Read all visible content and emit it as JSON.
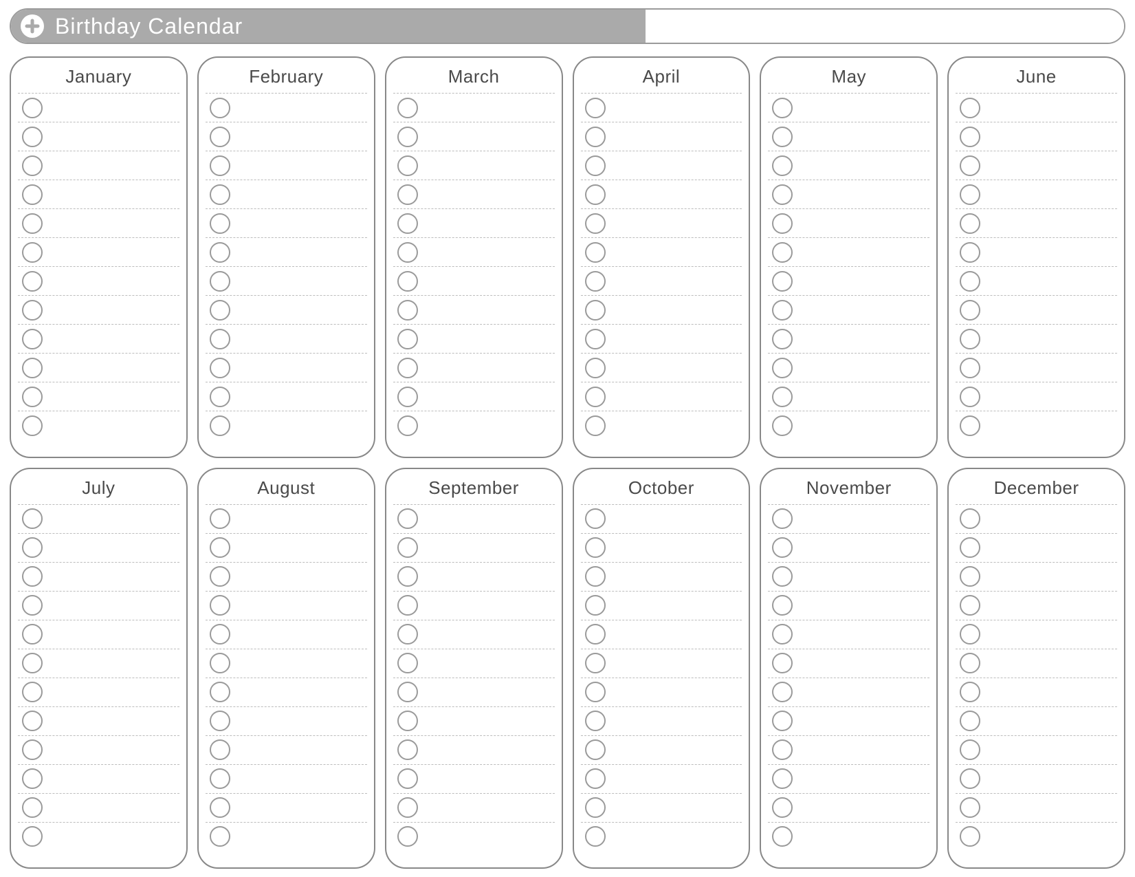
{
  "header": {
    "title": "Birthday Calendar",
    "icon": "plus-icon"
  },
  "months": [
    {
      "name": "January",
      "rows": 12
    },
    {
      "name": "February",
      "rows": 12
    },
    {
      "name": "March",
      "rows": 12
    },
    {
      "name": "April",
      "rows": 12
    },
    {
      "name": "May",
      "rows": 12
    },
    {
      "name": "June",
      "rows": 12
    },
    {
      "name": "July",
      "rows": 12
    },
    {
      "name": "August",
      "rows": 12
    },
    {
      "name": "September",
      "rows": 12
    },
    {
      "name": "October",
      "rows": 12
    },
    {
      "name": "November",
      "rows": 12
    },
    {
      "name": "December",
      "rows": 12
    }
  ],
  "colors": {
    "header_fill": "#aaaaaa",
    "border": "#888888",
    "dash": "#bcbcbc",
    "circle": "#9a9a9a",
    "title_text": "#4a4a4a"
  }
}
